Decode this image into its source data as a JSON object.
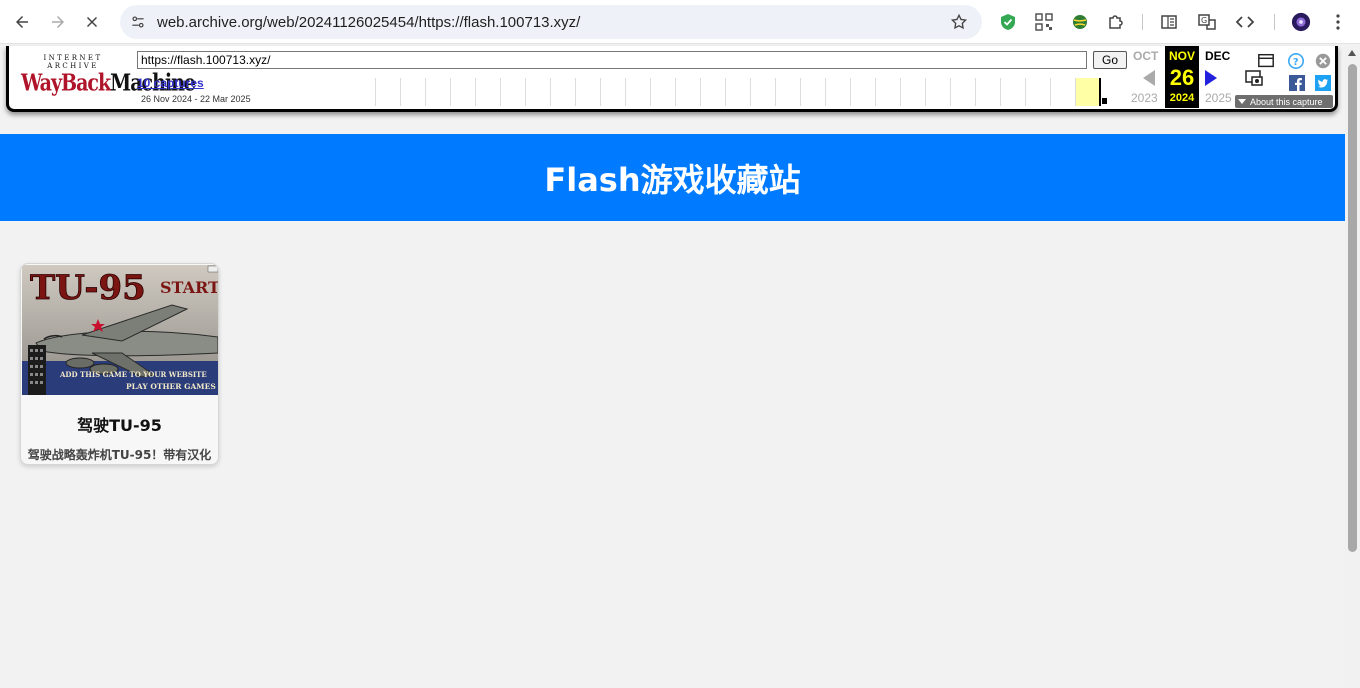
{
  "browser": {
    "url": "web.archive.org/web/20241126025454/https://flash.100713.xyz/",
    "icons": [
      "back-icon",
      "forward-icon",
      "stop-icon",
      "site-settings-icon",
      "star-icon",
      "shield-extension-icon",
      "qr-extension-icon",
      "globe-extension-icon",
      "puzzle-icon",
      "reading-list-icon",
      "translate-icon",
      "code-icon",
      "profile-avatar",
      "menu-icon"
    ]
  },
  "wayback": {
    "logo_top": "INTERNET ARCHIVE",
    "logo_main_red": "WayBack",
    "logo_main_black": "Machine",
    "url_value": "https://flash.100713.xyz/",
    "go_label": "Go",
    "captures_label": "10 captures",
    "range_label": "26 Nov 2024 - 22 Mar 2025",
    "prev_month": "OCT",
    "prev_year": "2023",
    "current_month": "NOV",
    "current_day": "26",
    "current_year": "2024",
    "next_month": "DEC",
    "next_year": "2025",
    "about_label": "About this capture"
  },
  "page": {
    "title": "Flash游戏收藏站",
    "accent_color": "#007bff",
    "games": [
      {
        "title": "驾驶TU-95",
        "description": "驾驶战略轰炸机TU-95！带有汉化",
        "thumb_title": "TU-95",
        "thumb_start": "START",
        "thumb_line1": "ADD THIS GAME TO YOUR WEBSITE",
        "thumb_line2": "PLAY OTHER GAMES"
      }
    ]
  }
}
